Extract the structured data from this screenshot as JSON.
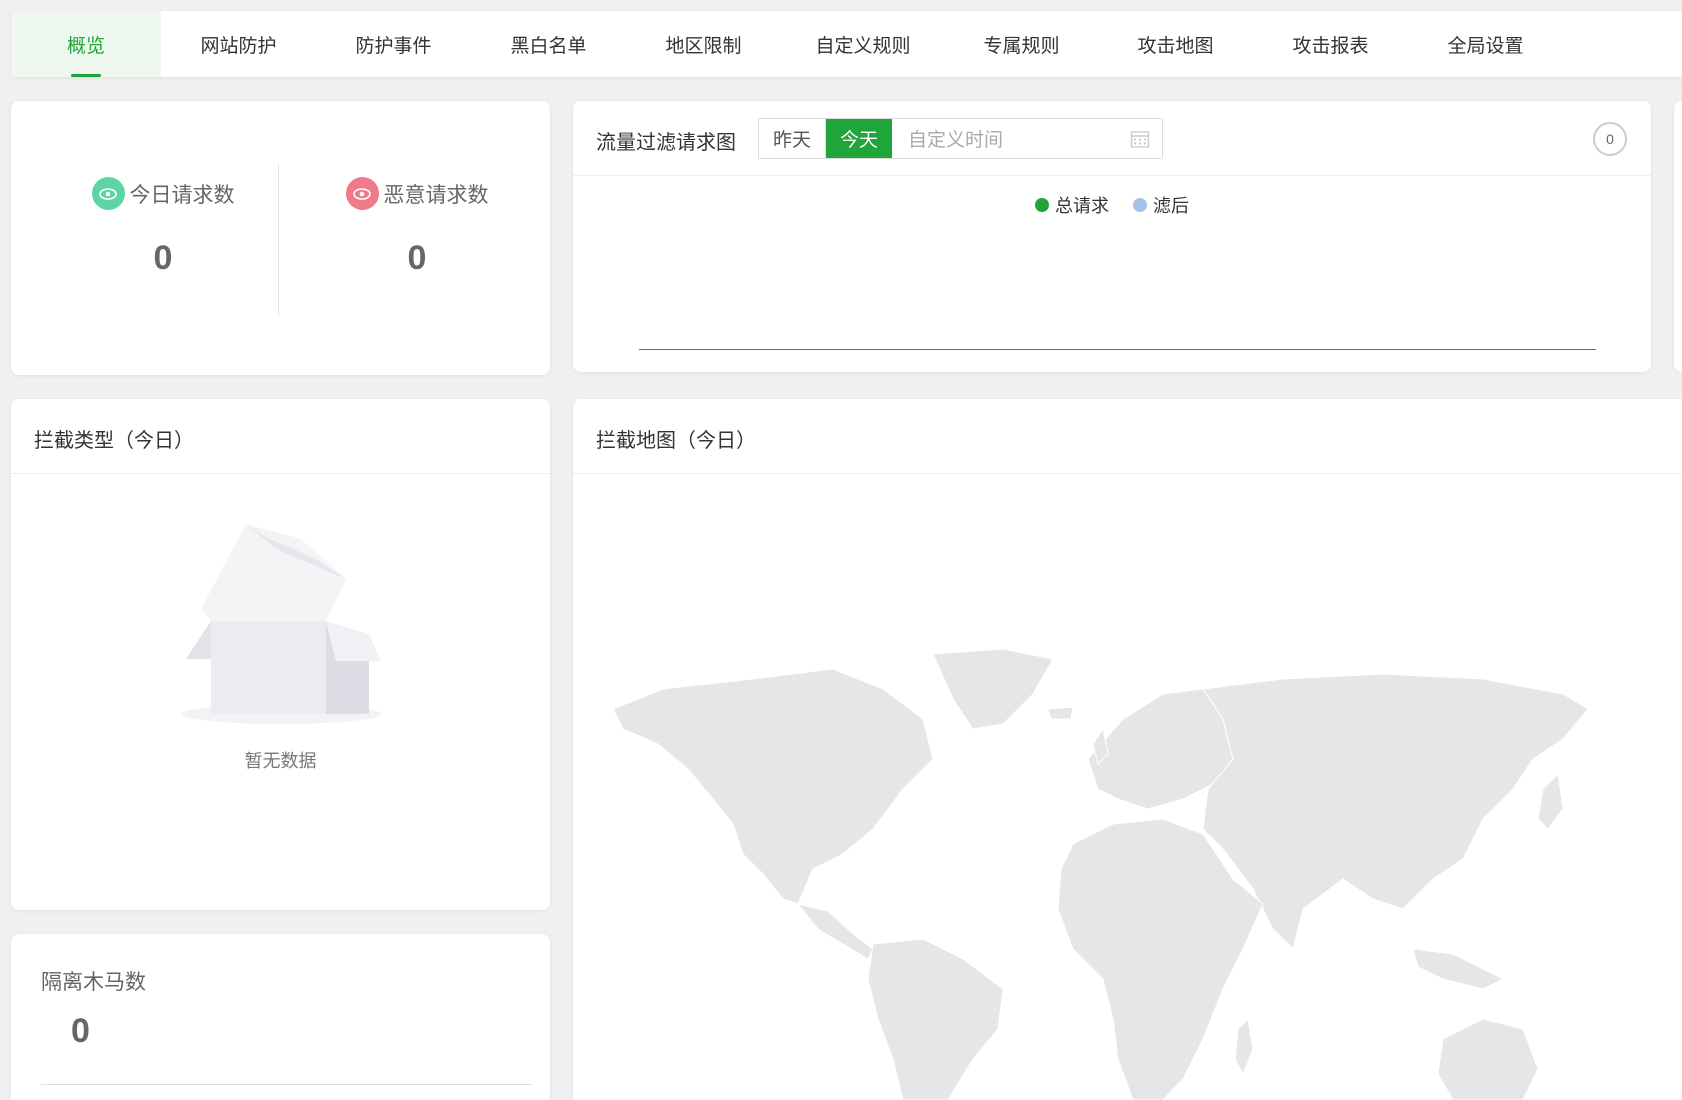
{
  "tabs": [
    {
      "label": "概览",
      "active": true
    },
    {
      "label": "网站防护"
    },
    {
      "label": "防护事件"
    },
    {
      "label": "黑白名单"
    },
    {
      "label": "地区限制"
    },
    {
      "label": "自定义规则"
    },
    {
      "label": "专属规则"
    },
    {
      "label": "攻击地图"
    },
    {
      "label": "攻击报表"
    },
    {
      "label": "全局设置"
    }
  ],
  "stats": {
    "today_requests": {
      "label": "今日请求数",
      "value": "0",
      "icon": "eye-icon",
      "color": "#5ed3a6"
    },
    "malicious_requests": {
      "label": "恶意请求数",
      "value": "0",
      "icon": "eye-icon",
      "color": "#ee7a8a"
    }
  },
  "traffic": {
    "title": "流量过滤请求图",
    "btn_yesterday": "昨天",
    "btn_today": "今天",
    "date_placeholder": "自定义时间",
    "refresh_count": "0",
    "legend": [
      {
        "name": "总请求",
        "color": "#20a53a"
      },
      {
        "name": "滤后",
        "color": "#a4c2e3"
      }
    ]
  },
  "intercept_type": {
    "title": "拦截类型（今日）",
    "empty_text": "暂无数据"
  },
  "intercept_map": {
    "title": "拦截地图（今日）"
  },
  "trojan": {
    "title": "隔离木马数",
    "value": "0"
  },
  "colors": {
    "accent": "#20a53a",
    "map_land": "#e6e6e6"
  }
}
